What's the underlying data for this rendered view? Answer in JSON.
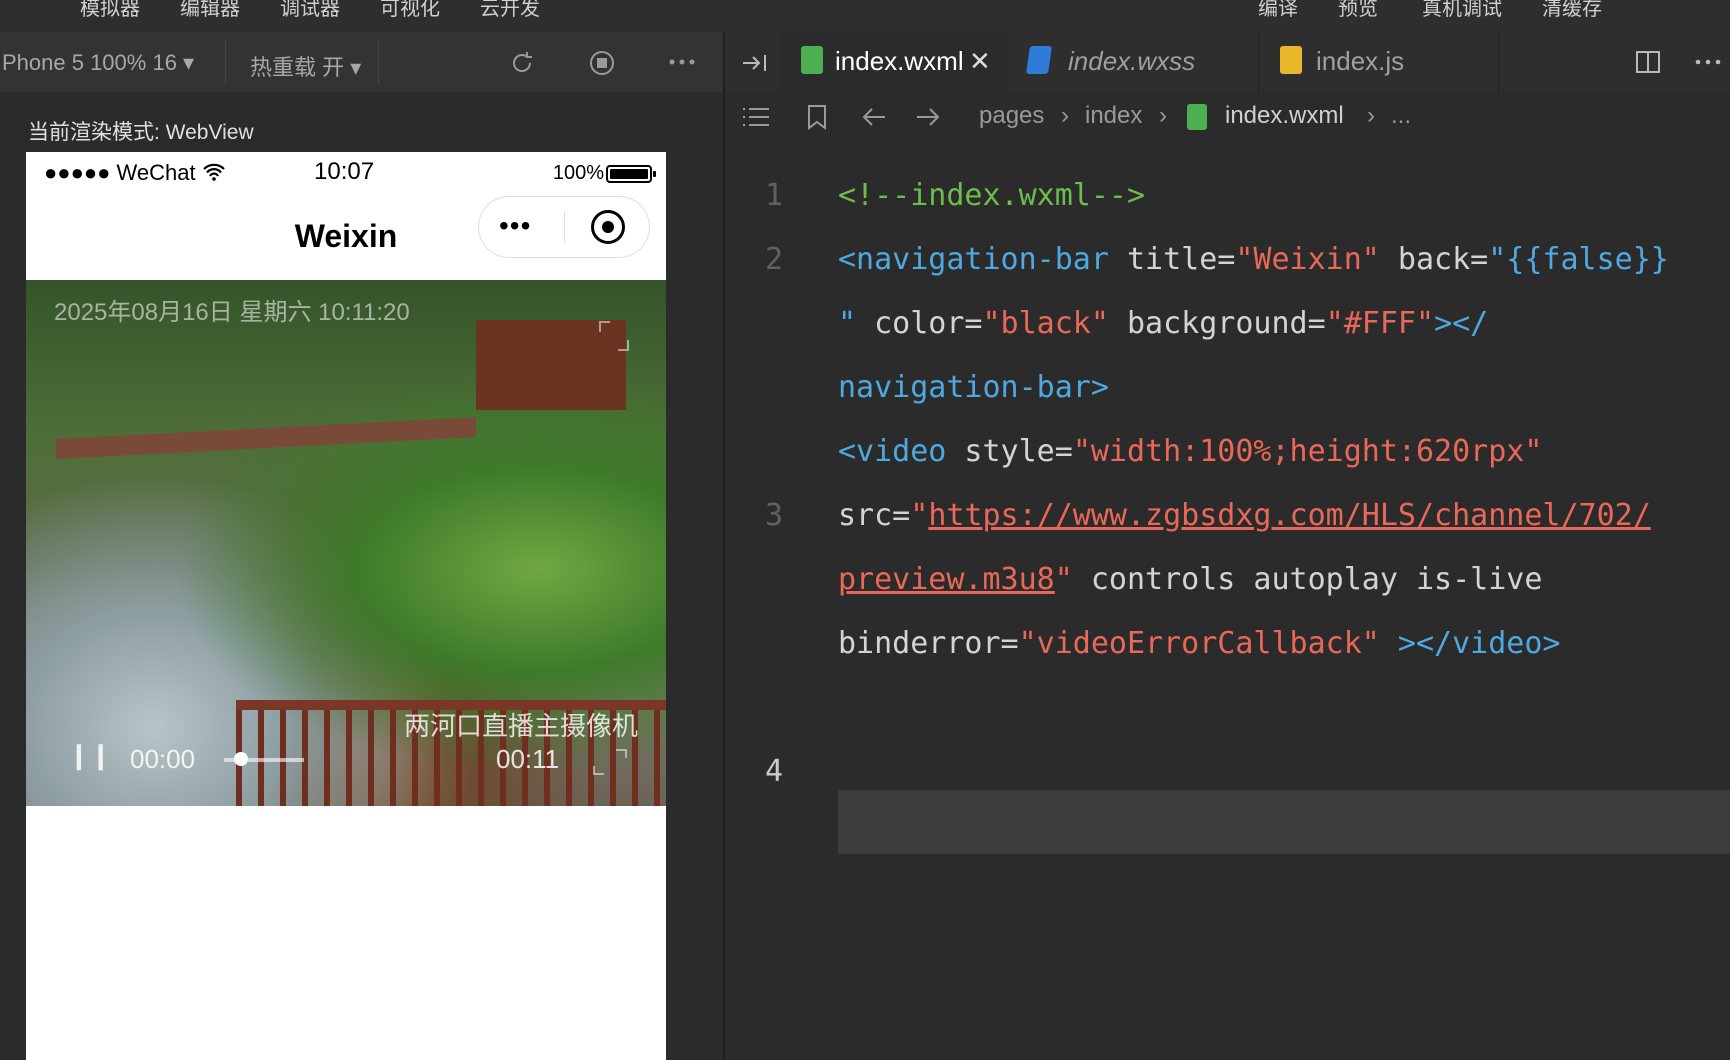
{
  "menu": {
    "items": [
      "模拟器",
      "编辑器",
      "调试器",
      "可视化",
      "云开发"
    ],
    "right_items": [
      "编译",
      "预览",
      "真机调试",
      "清缓存"
    ]
  },
  "sim_toolbar": {
    "device": "Phone 5 100% 16",
    "hot_reload": "热重载 开"
  },
  "render_mode": "当前渲染模式: WebView",
  "phone": {
    "carrier": "●●●●● WeChat",
    "time": "10:07",
    "battery": "100%",
    "nav_title": "Weixin",
    "capsule_dots": "•••",
    "video": {
      "timestamp": "2025年08月16日  星期六  10:11:20",
      "current_time": "00:00",
      "duration": "00:11",
      "camera_label": "两河口直播主摄像机",
      "play_glyph": "❙❙"
    }
  },
  "editor": {
    "tabs": [
      {
        "label": "index.wxml",
        "close": "✕"
      },
      {
        "label": "index.wxss"
      },
      {
        "label": "index.js"
      }
    ],
    "breadcrumb": [
      "pages",
      "index",
      "index.wxml",
      "..."
    ],
    "line_numbers": [
      "1",
      "2",
      "3",
      "4"
    ],
    "code": {
      "l1": "<!--index.wxml-->",
      "l2a_tag": "<navigation-bar",
      "l2a_attr1": " title=",
      "l2a_val1": "\"Weixin\"",
      "l2a_attr2": " back=",
      "l2a_val2": "\"{{false}}",
      "l2b_val2end": "\"",
      "l2b_attr3": " color=",
      "l2b_val3": "\"black\"",
      "l2b_attr4": " background=",
      "l2b_val4": "\"#FFF\"",
      "l2b_close": "></",
      "l2c": "navigation-bar>",
      "l3a_tag": "<video",
      "l3a_attr": " style=",
      "l3a_val": "\"width:100%;height:620rpx\"",
      "l3b_attr": "src=",
      "l3b_q": "\"",
      "l3b_url": "https://www.zgbsdxg.com/HLS/channel/702/",
      "l3c_url": "preview.m3u8",
      "l3c_q": "\"",
      "l3c_rest": " controls autoplay is-live",
      "l3d_attr": "binderror=",
      "l3d_val": "\"videoErrorCallback\"",
      "l3d_close": " ></video>"
    }
  }
}
